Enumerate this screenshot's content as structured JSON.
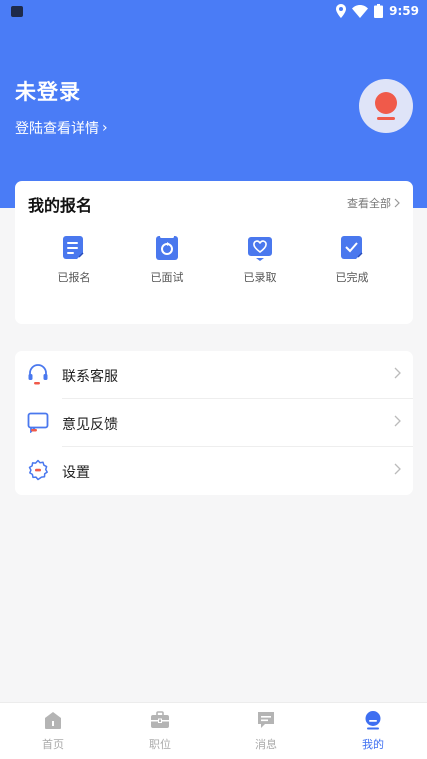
{
  "status_bar": {
    "time": "9:59"
  },
  "profile": {
    "title": "未登录",
    "subtitle": "登陆查看详情",
    "chevron": "›"
  },
  "signup": {
    "title": "我的报名",
    "more": "查看全部",
    "items": [
      {
        "label": "已报名",
        "icon": "list-doc-icon"
      },
      {
        "label": "已面试",
        "icon": "refresh-doc-icon"
      },
      {
        "label": "已录取",
        "icon": "heart-card-icon"
      },
      {
        "label": "已完成",
        "icon": "check-doc-icon"
      }
    ]
  },
  "menu": {
    "items": [
      {
        "label": "联系客服",
        "icon": "headset-icon"
      },
      {
        "label": "意见反馈",
        "icon": "feedback-icon"
      },
      {
        "label": "设置",
        "icon": "gear-icon"
      }
    ]
  },
  "tabbar": {
    "items": [
      {
        "label": "首页",
        "icon": "home-icon"
      },
      {
        "label": "职位",
        "icon": "briefcase-icon"
      },
      {
        "label": "消息",
        "icon": "message-icon"
      },
      {
        "label": "我的",
        "icon": "user-icon"
      }
    ],
    "active": "我的"
  },
  "colors": {
    "brand": "#4a7cf6",
    "accent_red": "#f05a4a",
    "icon_blue": "#4a78ee",
    "tab_active": "#3e6ff1",
    "tab_inactive": "#b4b4b4"
  }
}
